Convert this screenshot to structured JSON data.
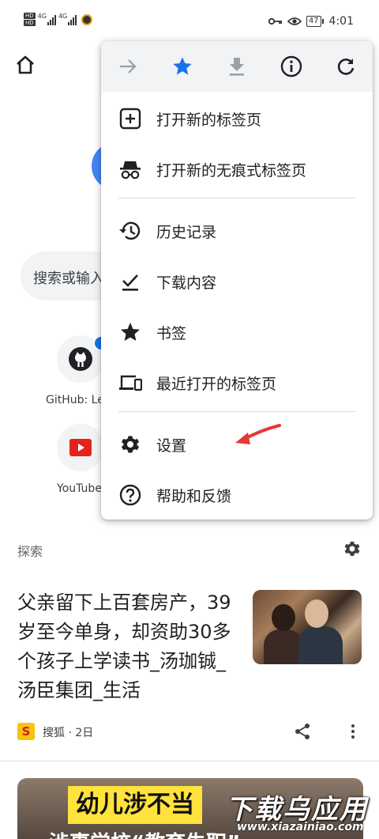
{
  "status_bar": {
    "hd1": "HD",
    "hd2": "HD",
    "net1": "4G",
    "net2": "4G",
    "battery": "47",
    "time": "4:01"
  },
  "page": {
    "search_placeholder": "搜索或输入网址",
    "tiles": [
      {
        "label": "GitHub: Le",
        "icon": "github-icon"
      },
      {
        "label": "YouTube",
        "icon": "youtube-icon"
      }
    ],
    "explore_label": "探索"
  },
  "article": {
    "title": "父亲留下上百套房产，39岁至今单身，却资助30多个孩子上学读书_汤珈铖_汤臣集团_生活",
    "source_logo": "S",
    "source": "搜狐 · 2日"
  },
  "card2": {
    "banner": "幼儿涉不当",
    "subtitle": "涉事学校“教育失职”"
  },
  "watermark": {
    "main": "下载乌应用",
    "url": "www.xiazainiao.com"
  },
  "menu": {
    "toolbar": [
      "forward-icon",
      "star-filled-icon",
      "download-icon",
      "info-icon",
      "refresh-icon"
    ],
    "items": [
      {
        "label": "打开新的标签页",
        "icon": "new-tab-icon"
      },
      {
        "label": "打开新的无痕式标签页",
        "icon": "incognito-icon"
      },
      {
        "label": "历史记录",
        "icon": "history-icon"
      },
      {
        "label": "下载内容",
        "icon": "downloads-icon"
      },
      {
        "label": "书签",
        "icon": "bookmarks-icon"
      },
      {
        "label": "最近打开的标签页",
        "icon": "recent-tabs-icon"
      },
      {
        "label": "设置",
        "icon": "settings-icon"
      },
      {
        "label": "帮助和反馈",
        "icon": "help-icon"
      }
    ]
  },
  "colors": {
    "accent": "#1a73e8",
    "arrow": "#e53935",
    "toolbar_bg": "#f1f3f4"
  }
}
